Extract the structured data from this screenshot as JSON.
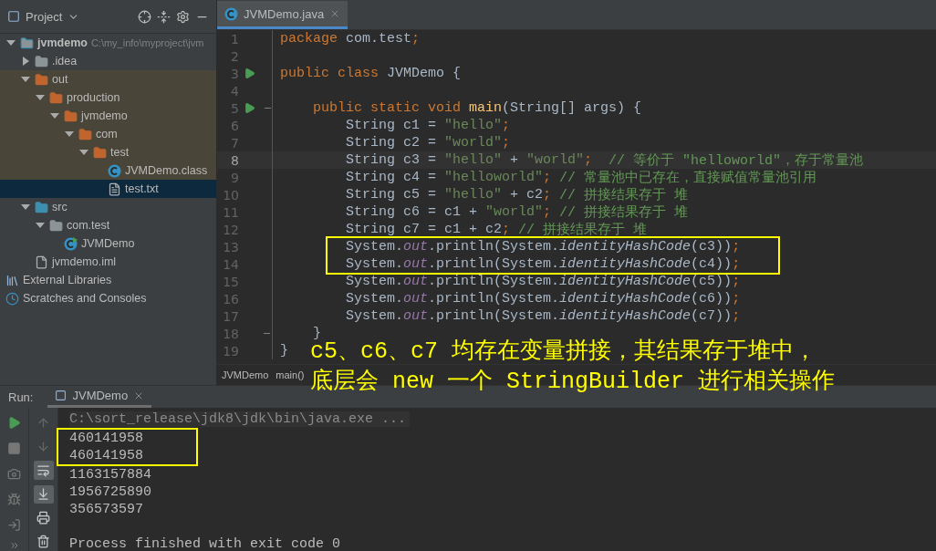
{
  "project": {
    "title": "Project",
    "tree": [
      {
        "label": "jvmdemo",
        "path": "C:\\my_info\\myproject\\jvm",
        "kind": "module",
        "expanded": true,
        "selected": false,
        "children": [
          {
            "label": ".idea",
            "kind": "folder",
            "expanded": false,
            "selected": false
          },
          {
            "label": "out",
            "kind": "excluded-folder",
            "excluded": true,
            "expanded": true,
            "selected": false,
            "children": [
              {
                "label": "production",
                "kind": "excluded-folder",
                "expanded": true,
                "selected": false,
                "children": [
                  {
                    "label": "jvmdemo",
                    "kind": "excluded-folder",
                    "expanded": true,
                    "selected": false,
                    "children": [
                      {
                        "label": "com",
                        "kind": "excluded-folder",
                        "expanded": true,
                        "selected": false,
                        "children": [
                          {
                            "label": "test",
                            "kind": "excluded-folder",
                            "expanded": true,
                            "selected": false,
                            "children": [
                              {
                                "label": "JVMDemo.class",
                                "kind": "class",
                                "selected": false
                              },
                              {
                                "label": "test.txt",
                                "kind": "text-file",
                                "selected": true
                              }
                            ]
                          }
                        ]
                      }
                    ]
                  }
                ]
              }
            ]
          },
          {
            "label": "src",
            "kind": "source-folder",
            "expanded": true,
            "selected": false,
            "children": [
              {
                "label": "com.test",
                "kind": "package",
                "expanded": true,
                "selected": false,
                "children": [
                  {
                    "label": "JVMDemo",
                    "kind": "runnable-class",
                    "selected": false
                  }
                ]
              }
            ]
          },
          {
            "label": "jvmdemo.iml",
            "kind": "iml-file",
            "selected": false
          }
        ]
      },
      {
        "label": "External Libraries",
        "kind": "libraries",
        "selected": false
      },
      {
        "label": "Scratches and Consoles",
        "kind": "scratches",
        "selected": false
      }
    ]
  },
  "editor": {
    "tabs": [
      {
        "label": "JVMDemo.java",
        "selected": true
      }
    ],
    "lines": [
      {
        "number": "1",
        "current": false,
        "tokens": [
          {
            "kind": "keyword",
            "text": "package"
          },
          {
            "kind": "plain",
            "text": " com.test"
          },
          {
            "kind": "keyword",
            "text": ";"
          }
        ]
      },
      {
        "number": "2",
        "current": false
      },
      {
        "number": "3",
        "current": false,
        "run": true,
        "tokens": [
          {
            "kind": "keyword",
            "text": "public class"
          },
          {
            "kind": "plain",
            "text": " JVMDemo {"
          }
        ]
      },
      {
        "number": "4",
        "current": false
      },
      {
        "number": "5",
        "current": false,
        "run": true,
        "fold": true,
        "tokens": [
          {
            "kind": "keyword",
            "text": "    public static void"
          },
          {
            "kind": "method",
            "text": "main"
          },
          {
            "kind": "plain",
            "text": "(String[] args) {"
          }
        ]
      },
      {
        "number": "6",
        "current": false,
        "tokens": [
          {
            "kind": "plain",
            "text": "        String c1 = "
          },
          {
            "kind": "string",
            "text": "\"hello\""
          },
          {
            "kind": "keyword",
            "text": ";"
          }
        ]
      },
      {
        "number": "7",
        "current": false,
        "tokens": [
          {
            "kind": "plain",
            "text": "        String c2 = "
          },
          {
            "kind": "string",
            "text": "\"world\""
          },
          {
            "kind": "keyword",
            "text": ";"
          }
        ]
      },
      {
        "number": "8",
        "current": true,
        "tokens": [
          {
            "kind": "plain",
            "text": "        String c3 = "
          },
          {
            "kind": "string",
            "text": "\"hello\""
          },
          {
            "kind": "plain",
            "text": " + "
          },
          {
            "kind": "string",
            "text": "\"world\""
          },
          {
            "kind": "keyword",
            "text": ";"
          },
          {
            "kind": "comment",
            "text": " // 等价于 \"helloworld\"，存于常量池"
          }
        ]
      },
      {
        "number": "9",
        "current": false,
        "tokens": [
          {
            "kind": "plain",
            "text": "        String c4 = "
          },
          {
            "kind": "string",
            "text": "\"helloworld\""
          },
          {
            "kind": "keyword",
            "text": ";"
          },
          {
            "kind": "comment",
            "text": "// 常量池中已存在，直接赋值常量池引用"
          }
        ]
      },
      {
        "number": "10",
        "current": false,
        "tokens": [
          {
            "kind": "plain",
            "text": "        String c5 = "
          },
          {
            "kind": "string",
            "text": "\"hello\""
          },
          {
            "kind": "plain",
            "text": " + c2"
          },
          {
            "kind": "keyword",
            "text": ";"
          },
          {
            "kind": "comment",
            "text": "// 拼接结果存于 堆"
          }
        ]
      },
      {
        "number": "11",
        "current": false,
        "tokens": [
          {
            "kind": "plain",
            "text": "        String c6 = c1 + "
          },
          {
            "kind": "string",
            "text": "\"world\""
          },
          {
            "kind": "keyword",
            "text": ";"
          },
          {
            "kind": "comment",
            "text": "// 拼接结果存于 堆"
          }
        ]
      },
      {
        "number": "12",
        "current": false,
        "tokens": [
          {
            "kind": "plain",
            "text": "        String c7 = c1 + c2"
          },
          {
            "kind": "keyword",
            "text": ";"
          },
          {
            "kind": "comment",
            "text": "// 拼接结果存于 堆"
          }
        ]
      },
      {
        "number": "13",
        "current": false,
        "boxed": true,
        "tokens": [
          {
            "kind": "plain",
            "text": "        System."
          },
          {
            "kind": "field",
            "text": "out"
          },
          {
            "kind": "plain",
            "text": ".println(System."
          },
          {
            "kind": "static",
            "text": "identityHashCode"
          },
          {
            "kind": "plain",
            "text": "(c3))"
          },
          {
            "kind": "keyword",
            "text": ";"
          }
        ]
      },
      {
        "number": "14",
        "current": false,
        "boxed": true,
        "tokens": [
          {
            "kind": "plain",
            "text": "        System."
          },
          {
            "kind": "field",
            "text": "out"
          },
          {
            "kind": "plain",
            "text": ".println(System."
          },
          {
            "kind": "static",
            "text": "identityHashCode"
          },
          {
            "kind": "plain",
            "text": "(c4))"
          },
          {
            "kind": "keyword",
            "text": ";"
          }
        ]
      },
      {
        "number": "15",
        "current": false,
        "tokens": [
          {
            "kind": "plain",
            "text": "        System."
          },
          {
            "kind": "field",
            "text": "out"
          },
          {
            "kind": "plain",
            "text": ".println(System."
          },
          {
            "kind": "static",
            "text": "identityHashCode"
          },
          {
            "kind": "plain",
            "text": "(c5))"
          },
          {
            "kind": "keyword",
            "text": ";"
          }
        ]
      },
      {
        "number": "16",
        "current": false,
        "tokens": [
          {
            "kind": "plain",
            "text": "        System."
          },
          {
            "kind": "field",
            "text": "out"
          },
          {
            "kind": "plain",
            "text": ".println(System."
          },
          {
            "kind": "static",
            "text": "identityHashCode"
          },
          {
            "kind": "plain",
            "text": "(c6))"
          },
          {
            "kind": "keyword",
            "text": ";"
          }
        ]
      },
      {
        "number": "17",
        "current": false,
        "tokens": [
          {
            "kind": "plain",
            "text": "        System."
          },
          {
            "kind": "field",
            "text": "out"
          },
          {
            "kind": "plain",
            "text": ".println(System."
          },
          {
            "kind": "static",
            "text": "identityHashCode"
          },
          {
            "kind": "plain",
            "text": "(c7))"
          },
          {
            "kind": "keyword",
            "text": ";"
          }
        ]
      },
      {
        "number": "18",
        "current": false,
        "fold": true,
        "tokens": [
          {
            "kind": "plain",
            "text": "    }"
          }
        ]
      },
      {
        "number": "19",
        "current": false,
        "tokens": [
          {
            "kind": "plain",
            "text": "}"
          }
        ]
      }
    ],
    "breadcrumb": [
      "JVMDemo",
      "main()"
    ]
  },
  "annotation": [
    "c5、c6、c7 均存在变量拼接，其结果存于堆中，",
    "底层会 new 一个 StringBuilder 进行相关操作"
  ],
  "run": {
    "label": "Run:",
    "tab": "JVMDemo",
    "left_tools": [
      {
        "kind": "run"
      },
      {
        "kind": "stop"
      },
      {
        "kind": "camera"
      },
      {
        "kind": "debug"
      },
      {
        "kind": "exit"
      }
    ],
    "right_tools": [
      {
        "kind": "up",
        "on": false
      },
      {
        "kind": "down",
        "on": false
      },
      {
        "kind": "wrap",
        "on": true
      },
      {
        "kind": "scroll-end",
        "on": true
      },
      {
        "kind": "print",
        "on": false
      },
      {
        "kind": "delete",
        "on": false
      }
    ],
    "console": [
      {
        "kind": "command",
        "text": "C:\\sort_release\\jdk8\\jdk\\bin\\java.exe ..."
      },
      {
        "kind": "output",
        "text": "460141958",
        "boxed": true
      },
      {
        "kind": "output",
        "text": "460141958",
        "boxed": true
      },
      {
        "kind": "output",
        "text": "1163157884"
      },
      {
        "kind": "output",
        "text": "1956725890"
      },
      {
        "kind": "output",
        "text": "356573597"
      },
      {
        "kind": "exit",
        "text": "Process finished with exit code 0"
      }
    ]
  }
}
